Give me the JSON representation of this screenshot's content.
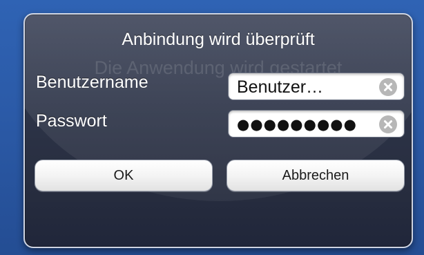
{
  "dialog": {
    "title": "Anbindung wird überprüft",
    "background_message": "Die Anwendung wird gestartet",
    "fields": {
      "username": {
        "label": "Benutzername",
        "value": "Benutzer…",
        "clear_icon": "clear-circle-x-icon"
      },
      "password": {
        "label": "Passwort",
        "value": "●●●●●●●●●",
        "clear_icon": "clear-circle-x-icon"
      }
    },
    "buttons": {
      "ok": "OK",
      "cancel": "Abbrechen"
    }
  },
  "colors": {
    "backdrop": "#2b5aa7",
    "dialog_background": "#2d3448",
    "dialog_border": "#cfd5e3",
    "button_background": "#f4f4f4",
    "clear_icon": "#b7b7b7"
  }
}
